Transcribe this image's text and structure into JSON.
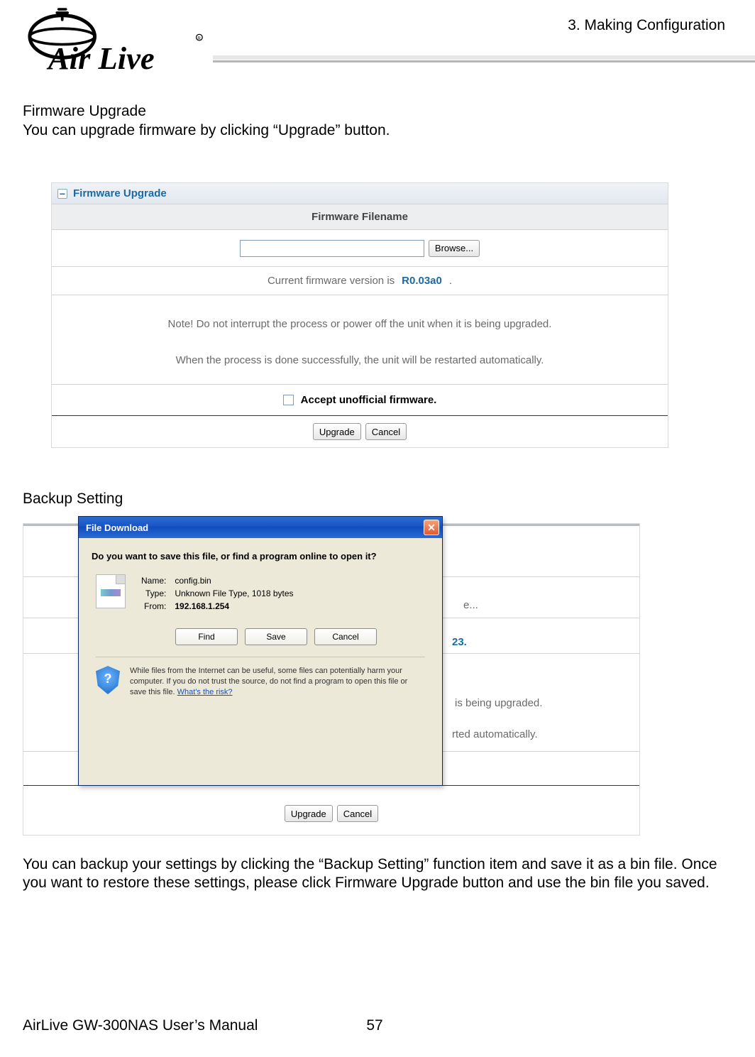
{
  "chapter": "3. Making Configuration",
  "logo_text": "Air Live",
  "section1": {
    "title": "Firmware Upgrade",
    "desc": "You can upgrade firmware by clicking “Upgrade” button."
  },
  "panel1": {
    "title": "Firmware Upgrade",
    "header": "Firmware Filename",
    "browse_label": "Browse...",
    "version_prefix": "Current firmware version is",
    "version_value": "R0.03a0",
    "version_suffix": ".",
    "note1": "Note! Do not interrupt the process or power off the unit when it is being upgraded.",
    "note2": "When the process is done successfully, the unit will be restarted automatically.",
    "chk_label": "Accept unofficial firmware.",
    "upgrade_btn": "Upgrade",
    "cancel_btn": "Cancel"
  },
  "section2": {
    "title": "Backup Setting",
    "desc": "You can backup your settings by clicking the “Backup Setting” function item and save it as a bin file. Once you want to restore these settings, please click Firmware Upgrade button and use the bin file you saved."
  },
  "bgpanel": {
    "browse_tail": "e...",
    "ver_tail": "23.",
    "line3": "is being upgraded.",
    "line4": "rted automatically.",
    "upgrade_btn": "Upgrade",
    "cancel_btn": "Cancel"
  },
  "dialog": {
    "title": "File Download",
    "question": "Do you want to save this file, or find a program online to open it?",
    "name_label": "Name:",
    "name_value": "config.bin",
    "type_label": "Type:",
    "type_value": "Unknown File Type, 1018 bytes",
    "from_label": "From:",
    "from_value": "192.168.1.254",
    "find_btn": "Find",
    "save_btn": "Save",
    "cancel_btn": "Cancel",
    "warning": "While files from the Internet can be useful, some files can potentially harm your computer. If you do not trust the source, do not find a program to open this file or save this file. ",
    "risk_link": "What's the risk?"
  },
  "footer": {
    "manual": "AirLive GW-300NAS User’s Manual",
    "page": "57"
  }
}
